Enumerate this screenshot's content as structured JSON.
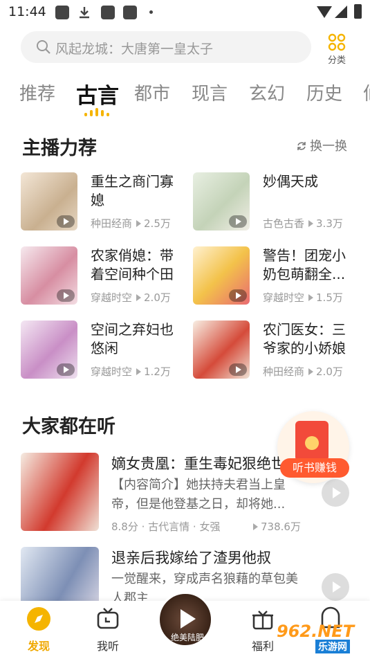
{
  "status_bar": {
    "time": "11:44"
  },
  "search": {
    "placeholder": "风起龙城：大唐第一皇太子"
  },
  "category": {
    "label": "分类"
  },
  "tabs": [
    "推荐",
    "古言",
    "都市",
    "现言",
    "玄幻",
    "历史",
    "仙"
  ],
  "active_tab": "古言",
  "section1": {
    "title": "主播力荐",
    "refresh_label": "换一换"
  },
  "recommended": [
    {
      "title": "重生之商门寡媳",
      "tag": "种田经商",
      "plays": "2.5万"
    },
    {
      "title": "妙偶天成",
      "tag": "古色古香",
      "plays": "3.3万"
    },
    {
      "title": "农家俏媳：带着空间种个田",
      "tag": "穿越时空",
      "plays": "2.0万"
    },
    {
      "title": "警告！团宠小奶包萌翻全...",
      "tag": "穿越时空",
      "plays": "1.5万"
    },
    {
      "title": "空间之弃妇也悠闲",
      "tag": "穿越时空",
      "plays": "1.2万"
    },
    {
      "title": "农门医女：三爷家的小娇娘",
      "tag": "种田经商",
      "plays": "2.0万"
    }
  ],
  "section2": {
    "title": "大家都在听"
  },
  "popular": [
    {
      "title": "嫡女贵凰：重生毒妃狠绝世",
      "desc": "【内容简介】她扶持夫君当上皇帝，但是他登基之日，却将她...",
      "meta": "8.8分 · 古代言情 · 女强",
      "plays": "738.6万"
    },
    {
      "title": "退亲后我嫁给了渣男他叔",
      "desc": "一觉醒来，穿成声名狼藉的草包美人郡主",
      "meta": "",
      "plays": ""
    }
  ],
  "promo": {
    "label": "听书赚钱"
  },
  "now_playing": {
    "title": "绝美陆肥"
  },
  "nav": [
    {
      "label": "发现",
      "icon": "compass-icon"
    },
    {
      "label": "我听",
      "icon": "tv-icon"
    },
    {
      "label": "福利",
      "icon": "gift-icon"
    },
    {
      "label": "我的",
      "icon": "profile-icon"
    }
  ],
  "watermark": {
    "brand": "962.NET",
    "sub": "乐游网"
  },
  "colors": {
    "accent": "#f5b400",
    "promo": "#ff5a2f"
  }
}
